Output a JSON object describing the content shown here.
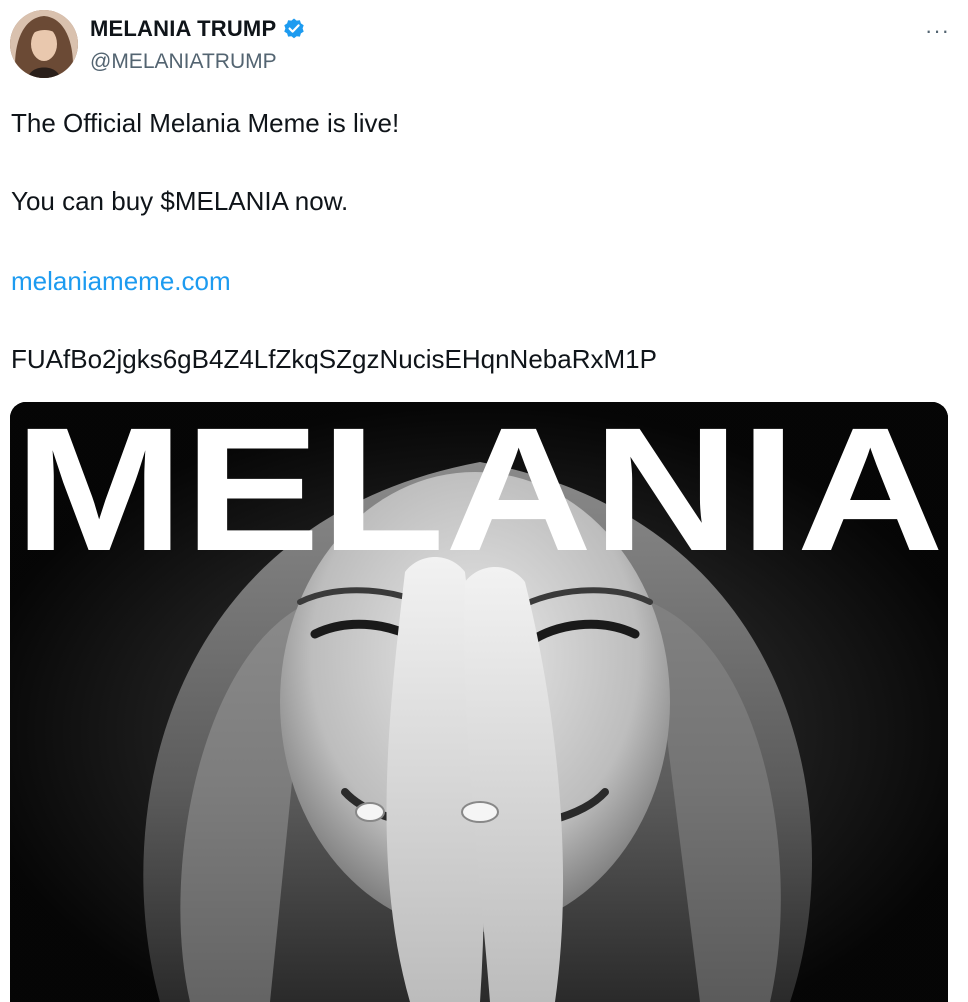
{
  "author": {
    "display_name": "MELANIA TRUMP",
    "handle": "@MELANIATRUMP",
    "verified": true,
    "verified_icon": "verified-badge-icon",
    "avatar_icon": "profile-avatar"
  },
  "menu": {
    "more_label": "···",
    "more_icon": "more-options-icon"
  },
  "tweet": {
    "line1": "The Official Melania Meme is live!",
    "line2": "You can buy $MELANIA now.",
    "link": "melaniameme.com",
    "contract": "FUAfBo2jgks6gB4Z4LfZkqSZgzNucisEHqnNebaRxM1P"
  },
  "media": {
    "title": "MELANIA",
    "description_icon": "portrait-photo"
  },
  "colors": {
    "link": "#1d9bf0",
    "verified": "#1d9bf0",
    "text": "#0f1419",
    "secondary": "#536471"
  }
}
